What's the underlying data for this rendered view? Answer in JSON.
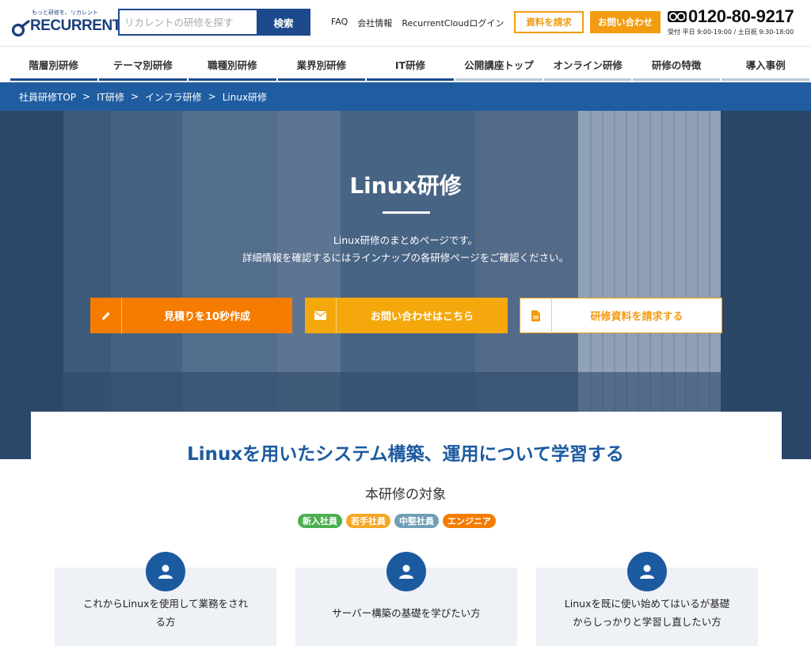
{
  "header": {
    "logo_tagline": "もっと研修を、リカレント",
    "logo_word": "RECURRENT",
    "search_placeholder": "リカレントの研修を探す",
    "search_button": "検索",
    "links": [
      "FAQ",
      "会社情報",
      "RecurrentCloudログイン"
    ],
    "doc_button": "資料を請求",
    "contact_button": "お問い合わせ",
    "phone": "0120-80-9217",
    "hours": "受付 平日 9:00-19:00 / 土日祝 9:30-18:00"
  },
  "nav": [
    {
      "label": "階層別研修",
      "w": 110
    },
    {
      "label": "テーマ別研修",
      "w": 112
    },
    {
      "label": "職種別研修",
      "w": 111
    },
    {
      "label": "業界別研修",
      "w": 111
    },
    {
      "label": "IT研修",
      "w": 110
    },
    {
      "label": "公開講座トップ",
      "w": 111
    },
    {
      "label": "オンライン研修",
      "w": 110
    },
    {
      "label": "研修の特徴",
      "w": 111
    },
    {
      "label": "導入事例",
      "w": 111
    }
  ],
  "breadcrumb": [
    "社員研修TOP",
    "IT研修",
    "インフラ研修",
    "Linux研修"
  ],
  "hero": {
    "title": "Linux研修",
    "desc_line1": "Linux研修のまとめページです。",
    "desc_line2": "詳細情報を確認するにはラインナップの各研修ページをご確認ください。",
    "cta_estimate": "見積りを10秒作成",
    "cta_contact": "お問い合わせはこちら",
    "cta_document": "研修資料を請求する"
  },
  "content": {
    "lead": "Linuxを用いたシステム構築、運用について学習する",
    "target_heading": "本研修の対象",
    "tags": [
      {
        "label": "新入社員",
        "color": "#4caf50"
      },
      {
        "label": "若手社員",
        "color": "#f5a623"
      },
      {
        "label": "中堅社員",
        "color": "#6f9fb6"
      },
      {
        "label": "エンジニア",
        "color": "#f57c00"
      }
    ],
    "targets": [
      {
        "line1": "これからLinuxを使用して業務をされ",
        "line2": "る方"
      },
      {
        "line1": "サーバー構築の基礎を学びたい方",
        "line2": ""
      },
      {
        "line1": "Linuxを既に使い始めてはいるが基礎",
        "line2": "からしっかりと学習し直したい方"
      }
    ]
  },
  "colors": {
    "brand_navy": "#1c4a8c",
    "breadcrumb_bg": "#1f5da0",
    "accent_orange": "#f57c00",
    "accent_yellow": "#f5a80c"
  }
}
